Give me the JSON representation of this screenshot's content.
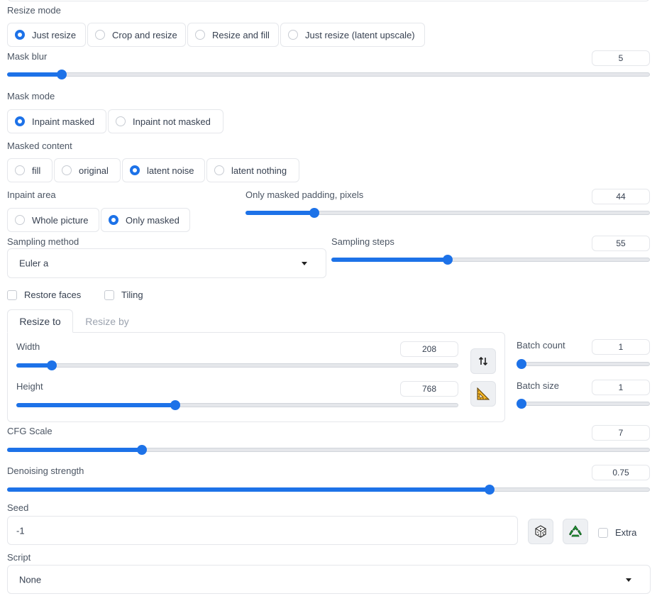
{
  "resize_mode": {
    "label": "Resize mode",
    "options": [
      "Just resize",
      "Crop and resize",
      "Resize and fill",
      "Just resize (latent upscale)"
    ],
    "selected": "Just resize"
  },
  "mask_blur": {
    "label": "Mask blur",
    "value": "5",
    "fraction": 0.085
  },
  "mask_mode": {
    "label": "Mask mode",
    "options": [
      "Inpaint masked",
      "Inpaint not masked"
    ],
    "selected": "Inpaint masked"
  },
  "masked_content": {
    "label": "Masked content",
    "options": [
      "fill",
      "original",
      "latent noise",
      "latent nothing"
    ],
    "selected": "latent noise"
  },
  "inpaint_area": {
    "label": "Inpaint area",
    "options": [
      "Whole picture",
      "Only masked"
    ],
    "selected": "Only masked"
  },
  "only_masked_padding": {
    "label": "Only masked padding, pixels",
    "value": "44",
    "fraction": 0.17
  },
  "sampling_method": {
    "label": "Sampling method",
    "value": "Euler a"
  },
  "sampling_steps": {
    "label": "Sampling steps",
    "value": "55",
    "fraction": 0.365
  },
  "restore_faces": {
    "label": "Restore faces",
    "checked": false
  },
  "tiling": {
    "label": "Tiling",
    "checked": false
  },
  "resize_tabs": {
    "tabs": [
      "Resize to",
      "Resize by"
    ],
    "active": "Resize to"
  },
  "width": {
    "label": "Width",
    "value": "208",
    "fraction": 0.08
  },
  "height": {
    "label": "Height",
    "value": "768",
    "fraction": 0.36
  },
  "swap_dims_icon": "swap-vertical-arrows-icon",
  "aspect_ratio_icon": "triangle-ruler-icon",
  "batch_count": {
    "label": "Batch count",
    "value": "1",
    "fraction": 0.0
  },
  "batch_size": {
    "label": "Batch size",
    "value": "1",
    "fraction": 0.0
  },
  "cfg_scale": {
    "label": "CFG Scale",
    "value": "7",
    "fraction": 0.21
  },
  "denoising_strength": {
    "label": "Denoising strength",
    "value": "0.75",
    "fraction": 0.75
  },
  "seed": {
    "label": "Seed",
    "value": "-1"
  },
  "random_seed_icon": "dice-icon",
  "reuse_seed_icon": "recycle-icon",
  "extra": {
    "label": "Extra",
    "checked": false
  },
  "script": {
    "label": "Script",
    "value": "None"
  },
  "colors": {
    "accent": "#1d72e8",
    "border": "#e5e7eb",
    "track": "#e5e7eb"
  }
}
